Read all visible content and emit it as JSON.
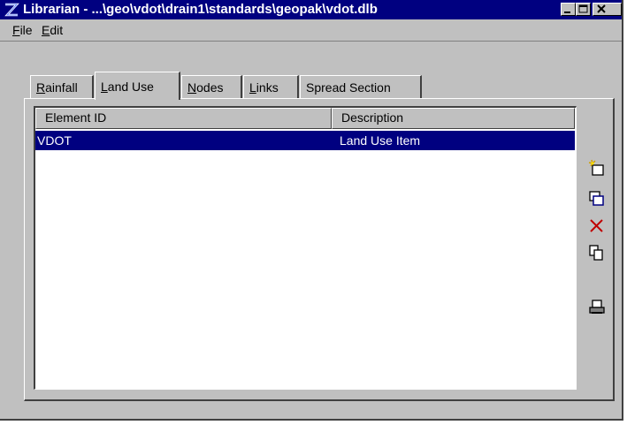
{
  "window": {
    "title": "Librarian - ...\\geo\\vdot\\drain1\\standards\\geopak\\vdot.dlb",
    "controls": [
      "minimize",
      "maximize",
      "close"
    ]
  },
  "menu": [
    {
      "label": "File",
      "mnemonic": "F",
      "rest": "ile"
    },
    {
      "label": "Edit",
      "mnemonic": "E",
      "rest": "dit"
    }
  ],
  "tabs": [
    {
      "label": "Rainfall",
      "mnemonic": "R",
      "rest": "ainfall",
      "active": false
    },
    {
      "label": "Land Use",
      "mnemonic": "L",
      "rest": "and Use",
      "active": true
    },
    {
      "label": "Nodes",
      "mnemonic": "N",
      "rest": "odes",
      "active": false
    },
    {
      "label": "Links",
      "mnemonic": "L",
      "rest": "inks",
      "active": false
    },
    {
      "label": "Spread Section",
      "mnemonic": "",
      "rest": "Spread Section",
      "active": false
    }
  ],
  "list": {
    "columns": [
      "Element ID",
      "Description"
    ],
    "rows": [
      {
        "element_id": "VDOT",
        "description": "Land Use Item",
        "selected": true
      }
    ]
  },
  "toolbar": {
    "icons": [
      "new-item-icon",
      "edit-item-icon",
      "delete-icon",
      "copy-icon",
      "print-icon"
    ]
  },
  "colors": {
    "titlebar": "#000080",
    "selection": "#000080",
    "face": "#c0c0c0",
    "delete": "#c00000"
  }
}
